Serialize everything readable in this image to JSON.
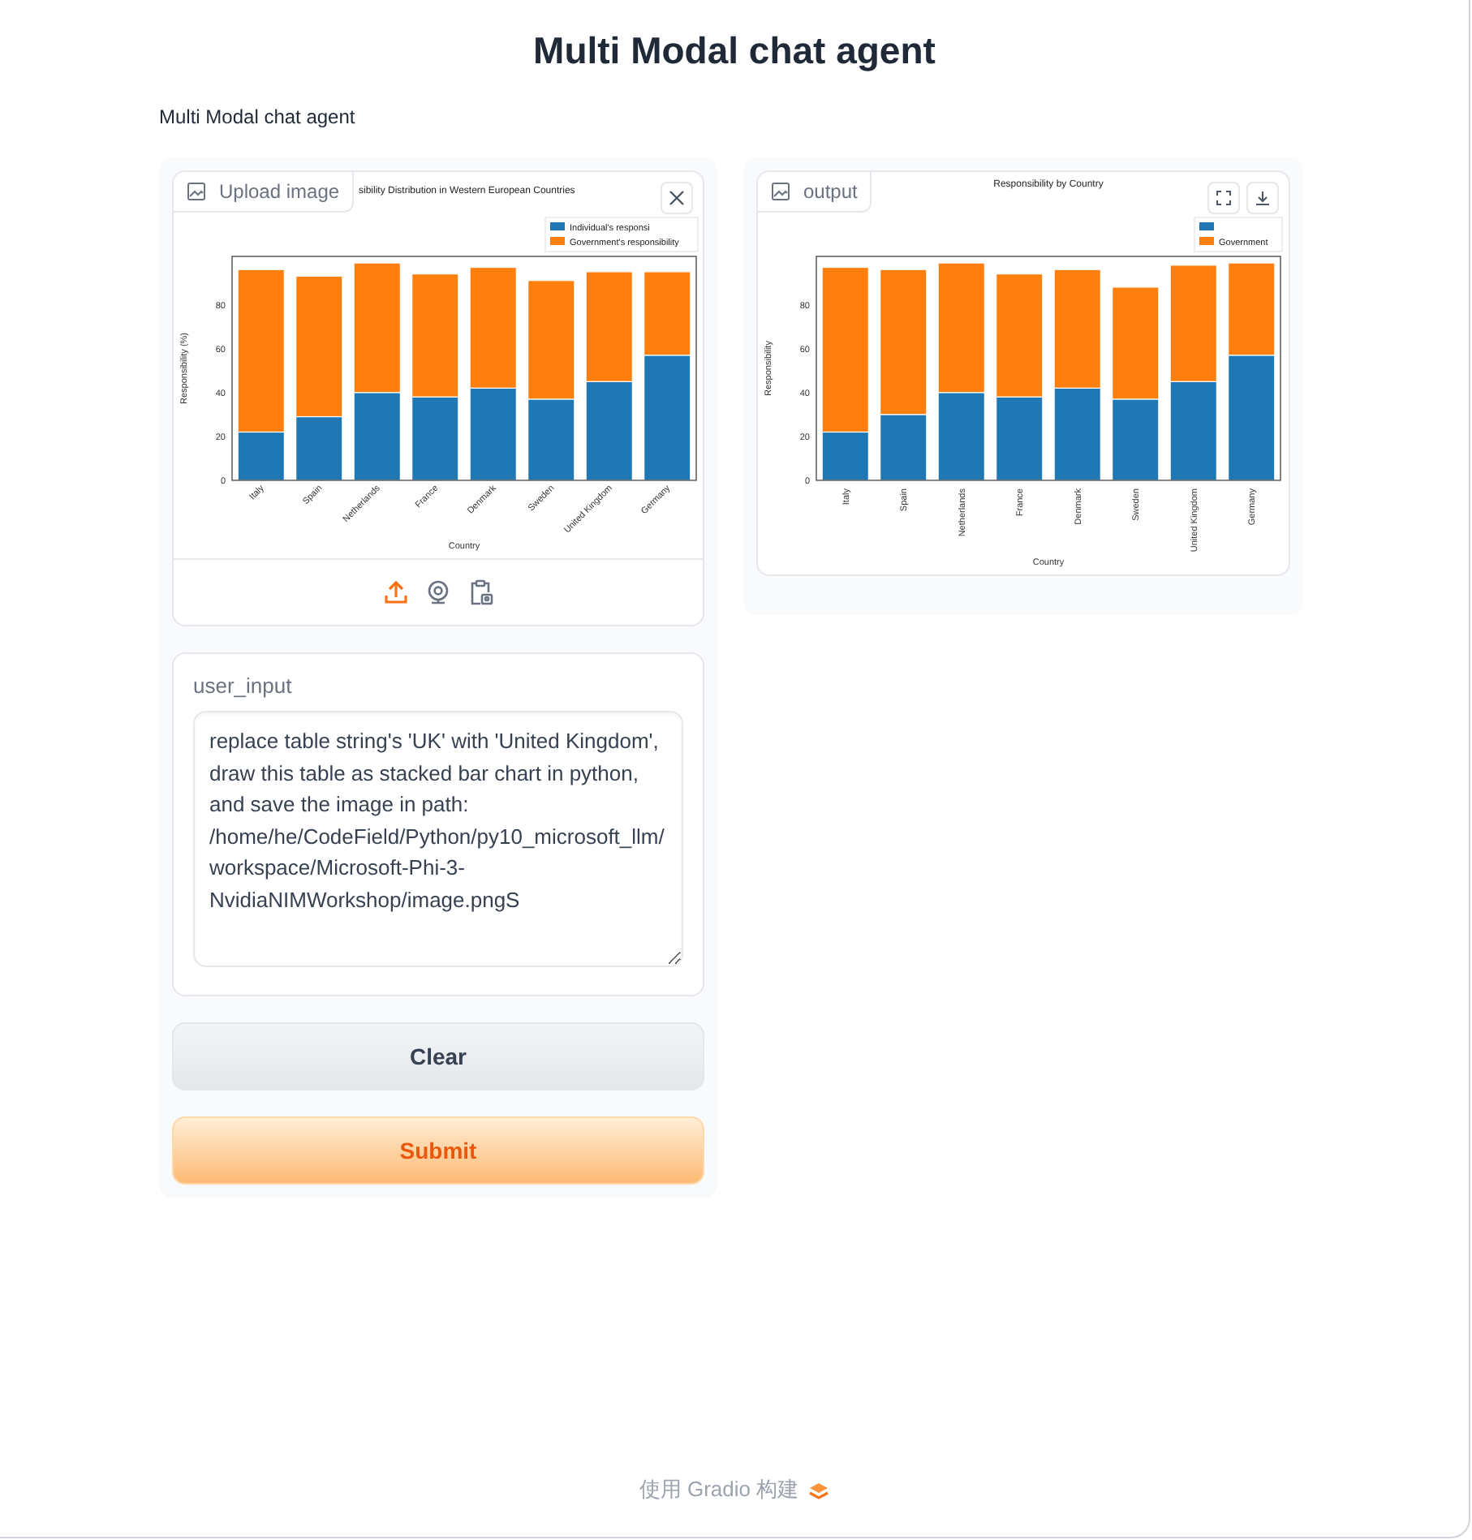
{
  "header": {
    "title": "Multi Modal chat agent",
    "description": "Multi Modal chat agent"
  },
  "image_input": {
    "label": "Upload image",
    "chart_data": {
      "type": "bar",
      "stacked": true,
      "title": "sibility Distribution in Western European Countries",
      "xlabel": "Country",
      "ylabel": "Responsibility (%)",
      "categories": [
        "Italy",
        "Spain",
        "Netherlands",
        "France",
        "Denmark",
        "Sweden",
        "United Kingdom",
        "Germany"
      ],
      "ylim": [
        0,
        102
      ],
      "yticks": [
        0,
        20,
        40,
        60,
        80
      ],
      "legend": "upper right",
      "series": [
        {
          "name": "Individual's responsi",
          "color": "#1f77b4",
          "values": [
            22,
            29,
            40,
            38,
            42,
            37,
            45,
            57
          ]
        },
        {
          "name": "Government's responsibility",
          "color": "#ff7f0e",
          "values": [
            74,
            64,
            59,
            56,
            55,
            54,
            50,
            38
          ]
        }
      ]
    }
  },
  "user_input": {
    "label": "user_input",
    "value": "replace table string's 'UK' with 'United Kingdom', draw this table as stacked bar chart in python, and save the image in path: /home/he/CodeField/Python/py10_microsoft_llm/workspace/Microsoft-Phi-3-NvidiaNIMWorkshop/image.pngS"
  },
  "buttons": [
    {
      "label": "Clear",
      "kind": "secondary"
    },
    {
      "label": "Submit",
      "kind": "primary"
    }
  ],
  "output": {
    "label": "output",
    "chart_data": {
      "type": "bar",
      "stacked": true,
      "title": "Responsibility by Country",
      "xlabel": "Country",
      "ylabel": "Responsibility",
      "categories": [
        "Italy",
        "Spain",
        "Netherlands",
        "France",
        "Denmark",
        "Sweden",
        "United Kingdom",
        "Germany"
      ],
      "ylim": [
        0,
        102
      ],
      "yticks": [
        0,
        20,
        40,
        60,
        80
      ],
      "legend": "upper right",
      "series": [
        {
          "color": "#1f77b4",
          "values": [
            22,
            30,
            40,
            38,
            42,
            37,
            45,
            57
          ]
        },
        {
          "name": "Government",
          "color": "#ff7f0e",
          "values": [
            75,
            66,
            59,
            56,
            54,
            51,
            53,
            42
          ]
        }
      ]
    }
  },
  "footer": {
    "text": "使用 Gradio 构建"
  }
}
